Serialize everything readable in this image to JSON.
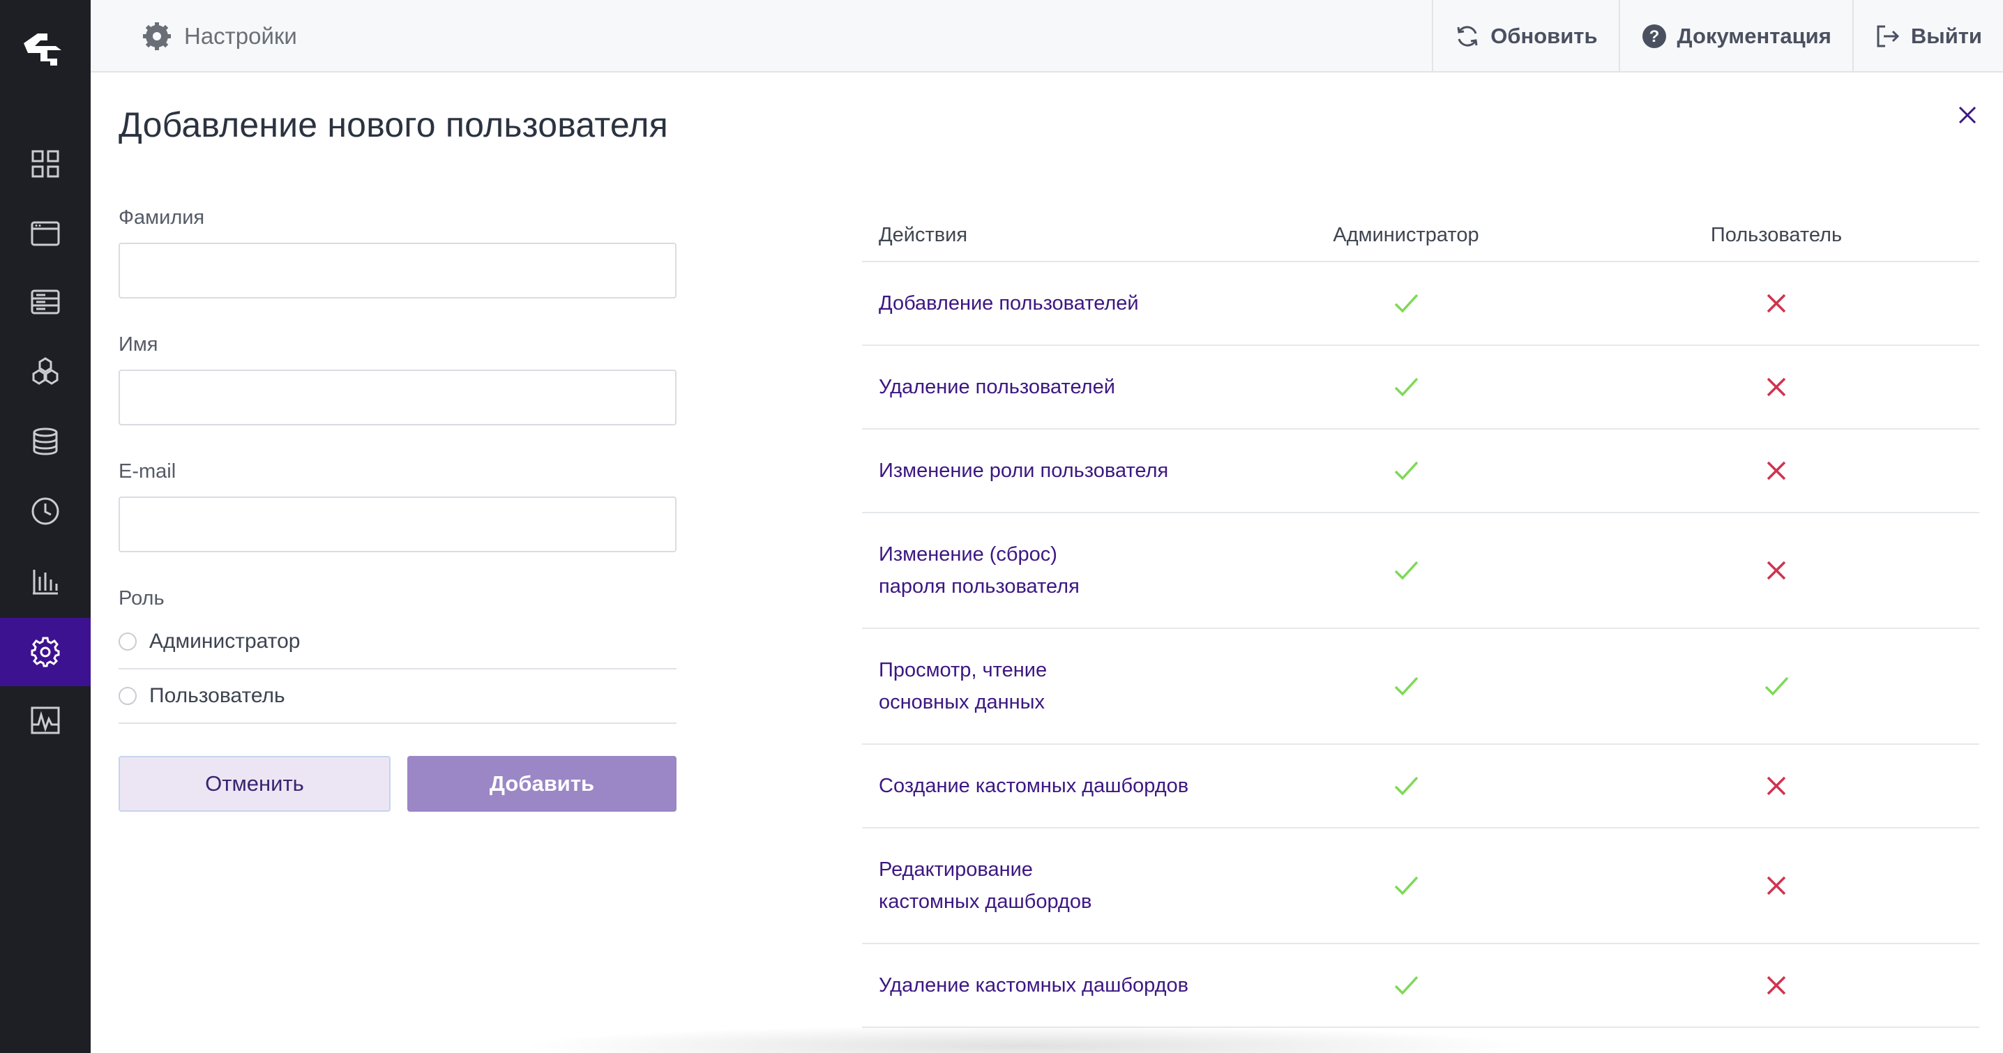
{
  "topbar": {
    "breadcrumb": "Настройки",
    "actions": [
      {
        "label": "Обновить",
        "icon": "refresh-icon"
      },
      {
        "label": "Документация",
        "icon": "help-icon"
      },
      {
        "label": "Выйти",
        "icon": "logout-icon"
      }
    ]
  },
  "sidebar": {
    "items": [
      {
        "icon": "grid-icon"
      },
      {
        "icon": "browser-window-icon"
      },
      {
        "icon": "server-list-icon"
      },
      {
        "icon": "hexagons-icon"
      },
      {
        "icon": "database-icon"
      },
      {
        "icon": "clock-icon"
      },
      {
        "icon": "bar-chart-icon"
      },
      {
        "icon": "gear-icon",
        "active": true
      },
      {
        "icon": "activity-icon"
      }
    ]
  },
  "page": {
    "title": "Добавление нового пользователя"
  },
  "form": {
    "last_name_label": "Фамилия",
    "last_name_value": "",
    "first_name_label": "Имя",
    "first_name_value": "",
    "email_label": "E-mail",
    "email_value": "",
    "role_label": "Роль",
    "role_admin": "Администратор",
    "role_user": "Пользователь",
    "cancel_label": "Отменить",
    "add_label": "Добавить"
  },
  "permissions": {
    "headers": [
      "Действия",
      "Администратор",
      "Пользователь"
    ],
    "rows": [
      {
        "action": "Добавление пользователей",
        "admin": true,
        "user": false
      },
      {
        "action": "Удаление пользователей",
        "admin": true,
        "user": false
      },
      {
        "action": "Изменение роли пользователя",
        "admin": true,
        "user": false
      },
      {
        "action": "Изменение (сброс) пароля пользователя",
        "admin": true,
        "user": false
      },
      {
        "action": "Просмотр, чтение основных данных",
        "admin": true,
        "user": true
      },
      {
        "action": "Создание кастомных дашбордов",
        "admin": true,
        "user": false
      },
      {
        "action": "Редактирование кастомных дашбордов",
        "admin": true,
        "user": false
      },
      {
        "action": "Удаление кастомных дашбордов",
        "admin": true,
        "user": false
      }
    ]
  },
  "colors": {
    "sidebar_bg": "#1e1f24",
    "sidebar_active": "#3d1290",
    "accent_text": "#3c1782",
    "check": "#7ed957",
    "cross": "#d0334f",
    "add_button": "#9b86c6"
  }
}
